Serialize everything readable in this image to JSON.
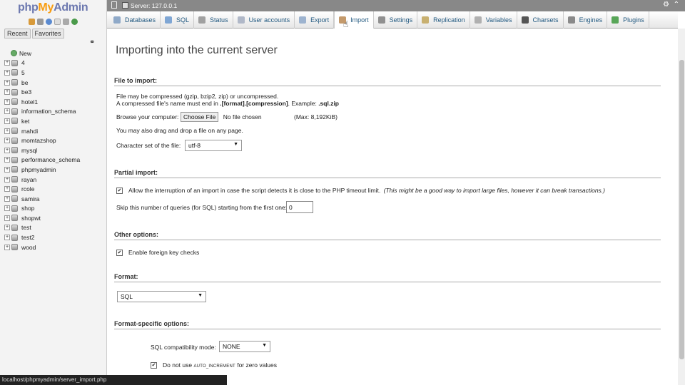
{
  "app": {
    "logo_php": "php",
    "logo_my": "My",
    "logo_admin": "Admin"
  },
  "nav": {
    "tabs": [
      "Recent",
      "Favorites"
    ],
    "new_label": "New",
    "databases": [
      "4",
      "5",
      "be",
      "be3",
      "hotel1",
      "information_schema",
      "ket",
      "mahdi",
      "momtazshop",
      "mysql",
      "performance_schema",
      "phpmyadmin",
      "rayan",
      "rcole",
      "samira",
      "shop",
      "shopwt",
      "test",
      "test2",
      "wood"
    ]
  },
  "server": {
    "label": "Server: 127.0.0.1"
  },
  "menu": [
    {
      "label": "Databases",
      "icon": "databases-icon",
      "color": "#8fa9c8"
    },
    {
      "label": "SQL",
      "icon": "sql-icon",
      "color": "#7fa6d4"
    },
    {
      "label": "Status",
      "icon": "status-icon",
      "color": "#a0a0a0"
    },
    {
      "label": "User accounts",
      "icon": "users-icon",
      "color": "#b0b8c8"
    },
    {
      "label": "Export",
      "icon": "export-icon",
      "color": "#9db3cf"
    },
    {
      "label": "Import",
      "icon": "import-icon",
      "color": "#c49a6c"
    },
    {
      "label": "Settings",
      "icon": "settings-icon",
      "color": "#909090"
    },
    {
      "label": "Replication",
      "icon": "replication-icon",
      "color": "#c8b070"
    },
    {
      "label": "Variables",
      "icon": "variables-icon",
      "color": "#b0b0b0"
    },
    {
      "label": "Charsets",
      "icon": "charsets-icon",
      "color": "#555555"
    },
    {
      "label": "Engines",
      "icon": "engines-icon",
      "color": "#8a8a8a"
    },
    {
      "label": "Plugins",
      "icon": "plugins-icon",
      "color": "#58a658"
    }
  ],
  "main": {
    "title": "Importing into the current server",
    "file_import": {
      "heading": "File to import:",
      "line1": "File may be compressed (gzip, bzip2, zip) or uncompressed.",
      "line2_pre": "A compressed file's name must end in ",
      "line2_bold": ".[format].[compression]",
      "line2_mid": ". Example: ",
      "line2_example": ".sql.zip",
      "browse_label": "Browse your computer:",
      "choose_button": "Choose File",
      "no_file": "No file chosen",
      "max_size": "(Max: 8,192KiB)",
      "drag_drop": "You may also drag and drop a file on any page.",
      "charset_label": "Character set of the file:",
      "charset_value": "utf-8"
    },
    "partial_import": {
      "heading": "Partial import:",
      "allow_interrupt": "Allow the interruption of an import in case the script detects it is close to the PHP timeout limit.",
      "allow_interrupt_note": "(This might be a good way to import large files, however it can break transactions.)",
      "skip_label": "Skip this number of queries (for SQL) starting from the first one:",
      "skip_value": "0"
    },
    "other_options": {
      "heading": "Other options:",
      "foreign_keys": "Enable foreign key checks"
    },
    "format": {
      "heading": "Format:",
      "value": "SQL"
    },
    "format_specific": {
      "heading": "Format-specific options:",
      "compat_label": "SQL compatibility mode:",
      "compat_value": "NONE",
      "no_auto_pre": "Do not use ",
      "no_auto_code": "AUTO_INCREMENT",
      "no_auto_post": " for zero values"
    }
  },
  "statusbar": {
    "url": "localhost/phpmyadmin/server_import.php"
  }
}
